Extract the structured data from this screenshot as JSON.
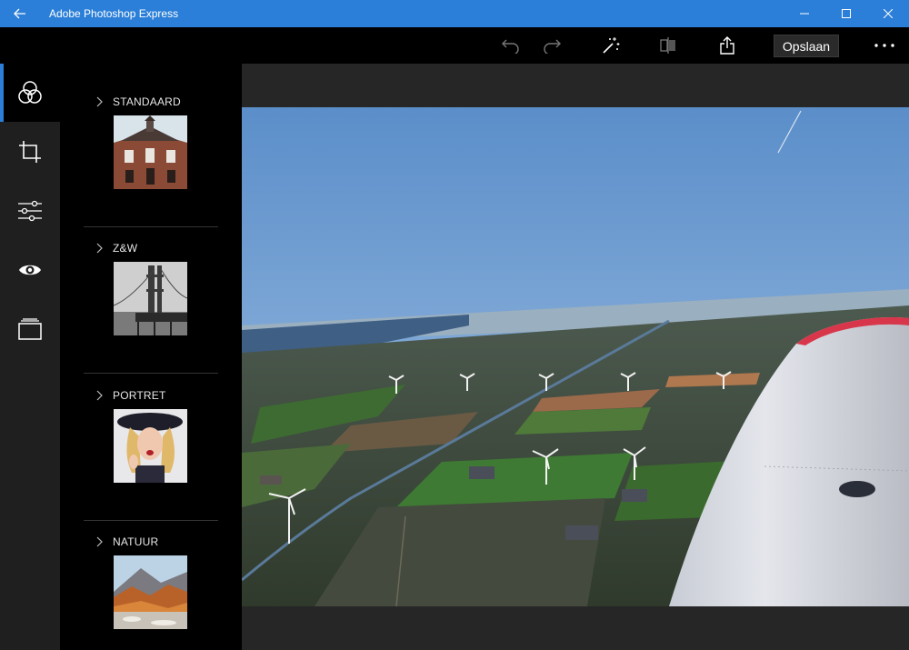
{
  "app": {
    "title": "Adobe Photoshop Express",
    "accent_color": "#2b7fd8"
  },
  "window_controls": [
    "minimize-icon",
    "maximize-icon",
    "close-icon"
  ],
  "toolbar": {
    "icons": [
      "undo-icon",
      "redo-icon",
      "magic-wand-icon",
      "compare-icon",
      "share-icon",
      "more-icon"
    ],
    "save_label": "Opslaan"
  },
  "rail": {
    "items": [
      {
        "icon": "looks-circles-icon",
        "active": true
      },
      {
        "icon": "crop-icon",
        "active": false
      },
      {
        "icon": "adjust-sliders-icon",
        "active": false
      },
      {
        "icon": "eye-icon",
        "active": false
      },
      {
        "icon": "borders-icon",
        "active": false
      }
    ]
  },
  "filters": {
    "categories": [
      {
        "label": "STANDAARD"
      },
      {
        "label": "Z&W"
      },
      {
        "label": "PORTRET"
      },
      {
        "label": "NATUUR"
      }
    ]
  }
}
